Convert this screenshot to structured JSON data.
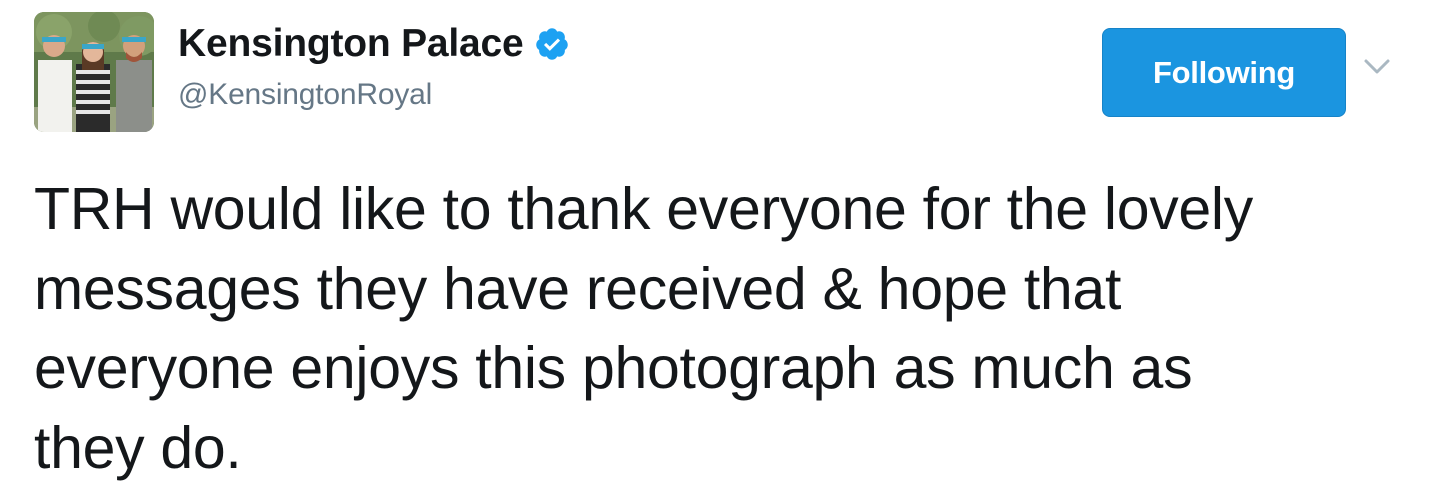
{
  "header": {
    "display_name": "Kensington Palace",
    "handle": "@KensingtonRoyal",
    "verified": true,
    "follow_button_label": "Following",
    "avatar_icon": "profile-photo",
    "caret_icon": "chevron-down-icon"
  },
  "tweet": {
    "lines": [
      "TRH would like to thank everyone for the lovely",
      "messages they have received & hope that",
      "everyone enjoys this photograph as much as",
      "they do."
    ]
  },
  "colors": {
    "accent": "#1b95e0",
    "verified_badge": "#1da1f2",
    "handle": "#657786",
    "text": "#14171a",
    "headband": "#3aa6c8"
  }
}
